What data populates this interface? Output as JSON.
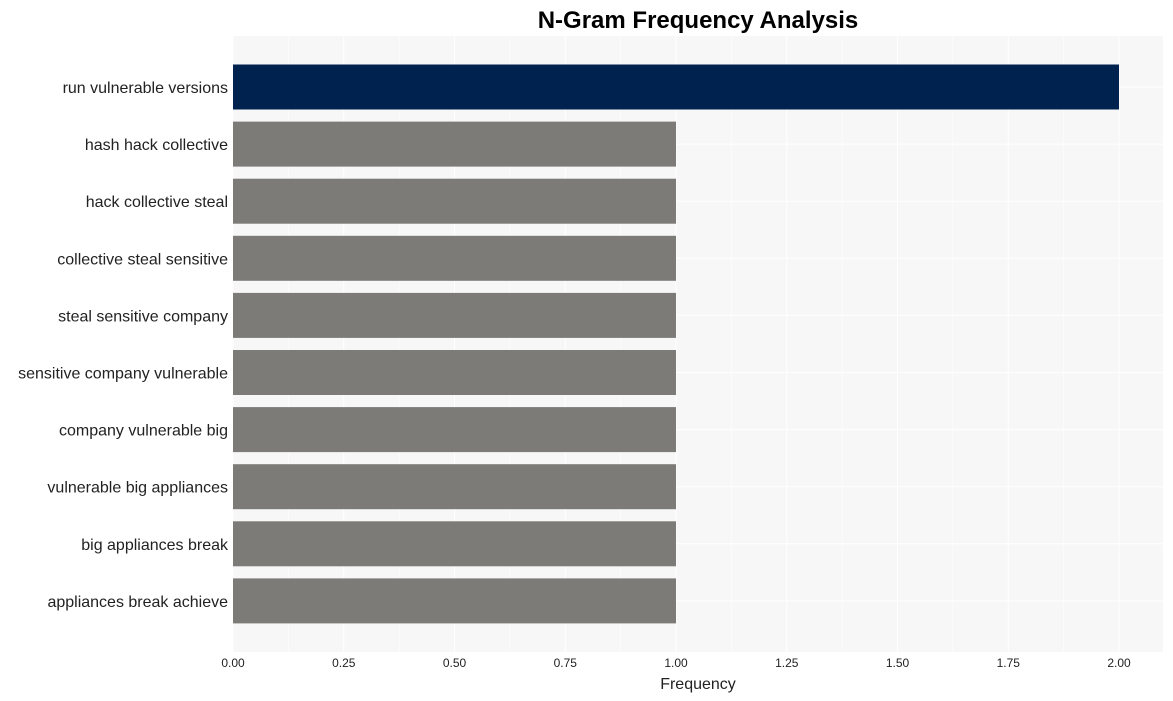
{
  "chart_data": {
    "type": "bar",
    "orientation": "horizontal",
    "title": "N-Gram Frequency Analysis",
    "xlabel": "Frequency",
    "ylabel": "",
    "categories": [
      "run vulnerable versions",
      "hash hack collective",
      "hack collective steal",
      "collective steal sensitive",
      "steal sensitive company",
      "sensitive company vulnerable",
      "company vulnerable big",
      "vulnerable big appliances",
      "big appliances break",
      "appliances break achieve"
    ],
    "values": [
      2,
      1,
      1,
      1,
      1,
      1,
      1,
      1,
      1,
      1
    ],
    "xlim": [
      0,
      2.1
    ],
    "xticks": [
      "0.00",
      "0.25",
      "0.50",
      "0.75",
      "1.00",
      "1.25",
      "1.50",
      "1.75",
      "2.00"
    ],
    "grid": true,
    "colors": {
      "highlight": "#00224e",
      "default": "#7c7b77",
      "background": "#f7f7f7",
      "grid": "#ffffff"
    }
  }
}
